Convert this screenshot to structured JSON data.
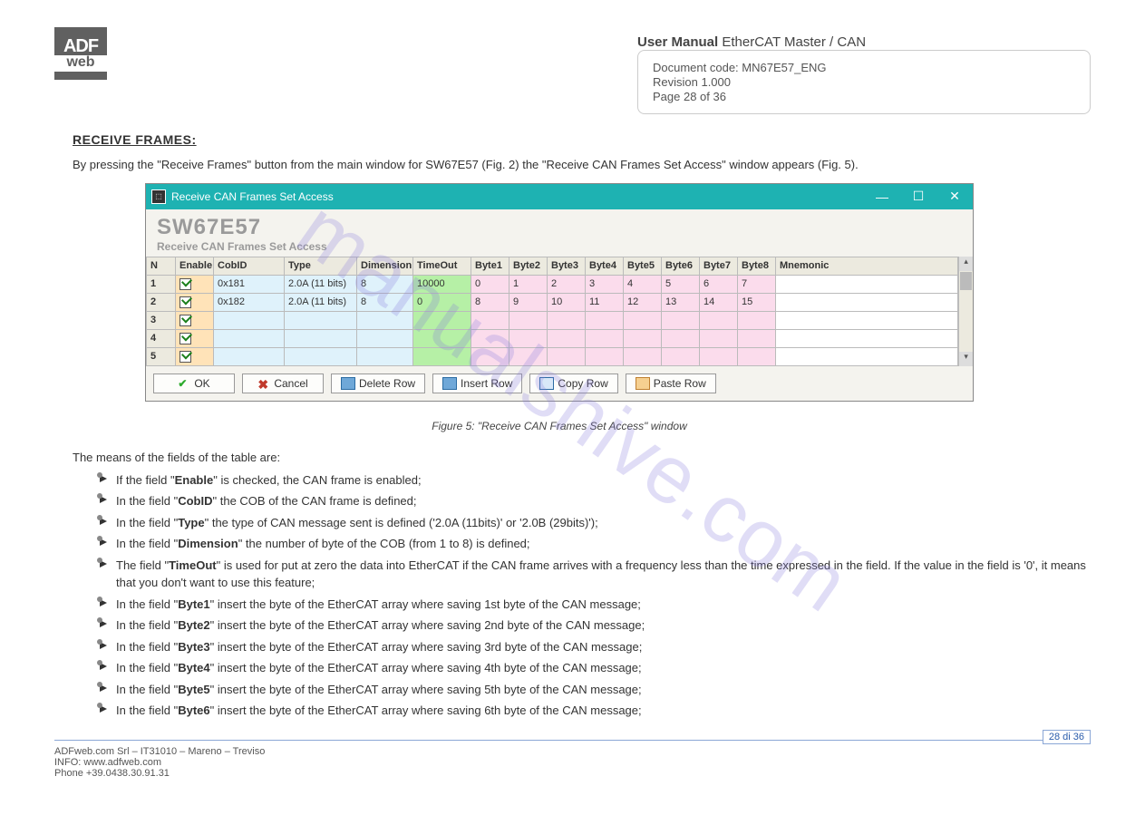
{
  "header": {
    "logo_top": "ADF",
    "logo_bot": "web",
    "box_l1": "Document code: MN67E57_ENG",
    "box_l2": "Revision 1.000",
    "box_l3": "Page 28 of 36",
    "um_title": "User Manual",
    "um_sub": "EtherCAT Master / CAN"
  },
  "section_title": "RECEIVE FRAMES:",
  "intro": "By pressing the \"Receive Frames\" button from the main window for SW67E57 (Fig. 2) the \"Receive CAN Frames Set Access\" window appears (Fig. 5).",
  "window": {
    "title": "Receive CAN Frames Set Access",
    "code": "SW67E57",
    "sub": "Receive CAN Frames Set Access",
    "cols": [
      "N",
      "Enable",
      "CobID",
      "Type",
      "Dimension",
      "TimeOut",
      "Byte1",
      "Byte2",
      "Byte3",
      "Byte4",
      "Byte5",
      "Byte6",
      "Byte7",
      "Byte8",
      "Mnemonic"
    ],
    "rows": [
      {
        "n": "1",
        "en": true,
        "cob": "0x181",
        "type": "2.0A (11 bits)",
        "dim": "8",
        "to": "10000",
        "b": [
          "0",
          "1",
          "2",
          "3",
          "4",
          "5",
          "6",
          "7"
        ],
        "mn": ""
      },
      {
        "n": "2",
        "en": true,
        "cob": "0x182",
        "type": "2.0A (11 bits)",
        "dim": "8",
        "to": "0",
        "b": [
          "8",
          "9",
          "10",
          "11",
          "12",
          "13",
          "14",
          "15"
        ],
        "mn": ""
      },
      {
        "n": "3",
        "en": true,
        "cob": "",
        "type": "",
        "dim": "",
        "to": "",
        "b": [
          "",
          "",
          "",
          "",
          "",
          "",
          "",
          ""
        ],
        "mn": ""
      },
      {
        "n": "4",
        "en": true,
        "cob": "",
        "type": "",
        "dim": "",
        "to": "",
        "b": [
          "",
          "",
          "",
          "",
          "",
          "",
          "",
          ""
        ],
        "mn": ""
      },
      {
        "n": "5",
        "en": true,
        "cob": "",
        "type": "",
        "dim": "",
        "to": "",
        "b": [
          "",
          "",
          "",
          "",
          "",
          "",
          "",
          ""
        ],
        "mn": ""
      }
    ],
    "buttons": {
      "ok": "OK",
      "cancel": "Cancel",
      "del": "Delete Row",
      "ins": "Insert Row",
      "copy": "Copy Row",
      "paste": "Paste Row"
    }
  },
  "caption": "Figure 5: \"Receive CAN Frames Set Access\" window",
  "means": "The means of the fields of the table are:",
  "bullets": [
    "If the field \"<b>Enable</b>\" is checked, the CAN frame is enabled;",
    "In the field \"<b>CobID</b>\" the COB of the CAN frame is defined;",
    "In the field \"<b>Type</b>\" the type of CAN message sent is defined ('2.0A (11bits)' or '2.0B (29bits)');",
    "In the field \"<b>Dimension</b>\" the number of byte of the COB (from 1 to 8) is defined;",
    "The field \"<b>TimeOut</b>\" is used for put at zero the data into EtherCAT if the CAN frame arrives with a frequency less than the time expressed in the field. If the value in the field is '0', it means that you don't want to use this feature;",
    "In the field \"<b>Byte1</b>\" insert the byte of the EtherCAT array where saving 1st byte of the CAN message;",
    "In the field \"<b>Byte2</b>\" insert the byte of the EtherCAT array where saving 2nd byte of the CAN message;",
    "In the field \"<b>Byte3</b>\" insert the byte of the EtherCAT array where saving 3rd byte of the CAN message;",
    "In the field \"<b>Byte4</b>\" insert the byte of the EtherCAT array where saving 4th byte of the CAN message;",
    "In the field \"<b>Byte5</b>\" insert the byte of the EtherCAT array where saving 5th byte of the CAN message;",
    "In the field \"<b>Byte6</b>\" insert the byte of the EtherCAT array where saving 6th byte of the CAN message;"
  ],
  "footer": {
    "line1": "ADFweb.com Srl – IT31010 – Mareno – Treviso",
    "line2": "INFO: www.adfweb.com",
    "line3": "Phone +39.0438.30.91.31",
    "page": "28 di 36"
  },
  "watermark": "manualshive.com"
}
